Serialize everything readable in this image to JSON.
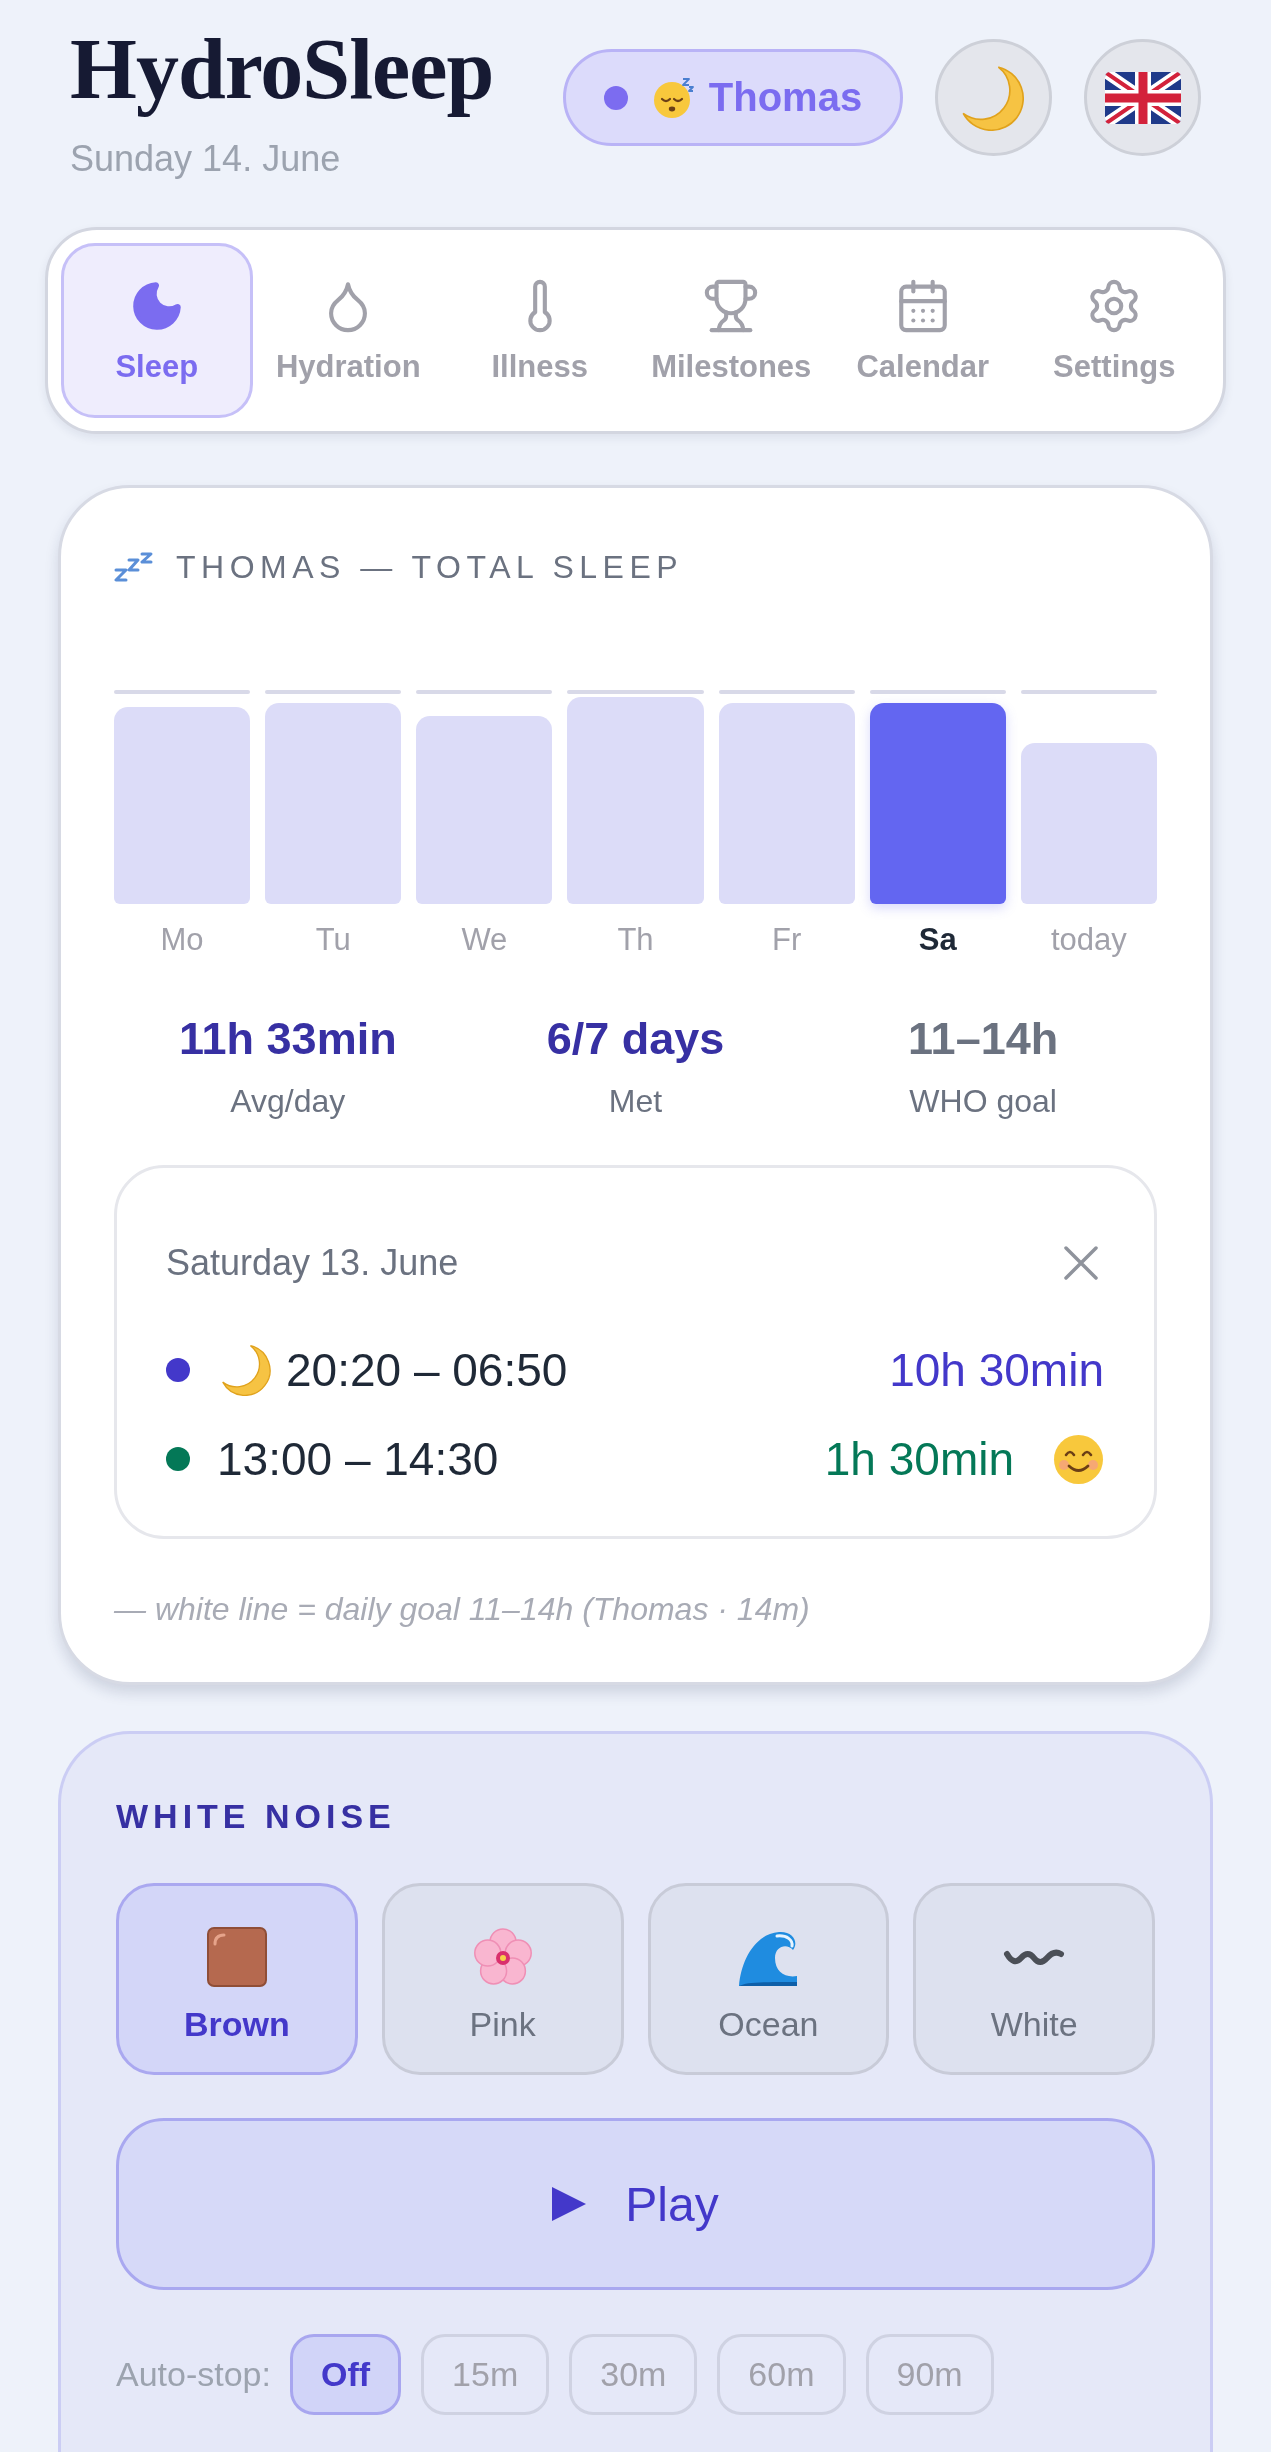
{
  "header": {
    "title": "HydroSleep",
    "date": "Sunday 14. June",
    "profile": {
      "name": "Thomas"
    }
  },
  "nav": {
    "tabs": [
      {
        "label": "Sleep",
        "kind": "moon",
        "selected": true
      },
      {
        "label": "Hydration",
        "kind": "drop",
        "selected": false
      },
      {
        "label": "Illness",
        "kind": "thermometer",
        "selected": false
      },
      {
        "label": "Milestones",
        "kind": "trophy",
        "selected": false
      },
      {
        "label": "Calendar",
        "kind": "calendar",
        "selected": false
      },
      {
        "label": "Settings",
        "kind": "gear",
        "selected": false
      }
    ]
  },
  "sleep_card": {
    "title": "THOMAS — TOTAL SLEEP",
    "days": [
      {
        "label": "Mo",
        "selected": false
      },
      {
        "label": "Tu",
        "selected": false
      },
      {
        "label": "We",
        "selected": false
      },
      {
        "label": "Th",
        "selected": false
      },
      {
        "label": "Fr",
        "selected": false
      },
      {
        "label": "Sa",
        "selected": true
      },
      {
        "label": "today",
        "selected": false
      }
    ],
    "stats": [
      {
        "value": "11h 33min",
        "label": "Avg/day",
        "muted": false
      },
      {
        "value": "6/7 days",
        "label": "Met",
        "muted": false
      },
      {
        "value": "11–14h",
        "label": "WHO goal",
        "muted": true
      }
    ],
    "detail": {
      "title": "Saturday 13. June",
      "entries": [
        {
          "kind": "night",
          "time": "20:20 – 06:50",
          "duration": "10h 30min",
          "color": "#4338ca"
        },
        {
          "kind": "nap",
          "time": "13:00 – 14:30",
          "duration": "1h 30min",
          "color": "#047857"
        }
      ]
    },
    "footnote": "— white line = daily goal 11–14h (Thomas · 14m)"
  },
  "white_noise": {
    "title": "WHITE NOISE",
    "sounds": [
      {
        "label": "Brown",
        "kind": "square",
        "selected": true
      },
      {
        "label": "Pink",
        "kind": "blossom",
        "selected": false
      },
      {
        "label": "Ocean",
        "kind": "wave",
        "selected": false
      },
      {
        "label": "White",
        "kind": "squiggle",
        "selected": false
      }
    ],
    "play": {
      "label": "Play"
    },
    "auto_stop": {
      "label": "Auto-stop:",
      "options": [
        {
          "label": "Off",
          "selected": true
        },
        {
          "label": "15m",
          "selected": false
        },
        {
          "label": "30m",
          "selected": false
        },
        {
          "label": "60m",
          "selected": false
        },
        {
          "label": "90m",
          "selected": false
        }
      ]
    }
  }
}
